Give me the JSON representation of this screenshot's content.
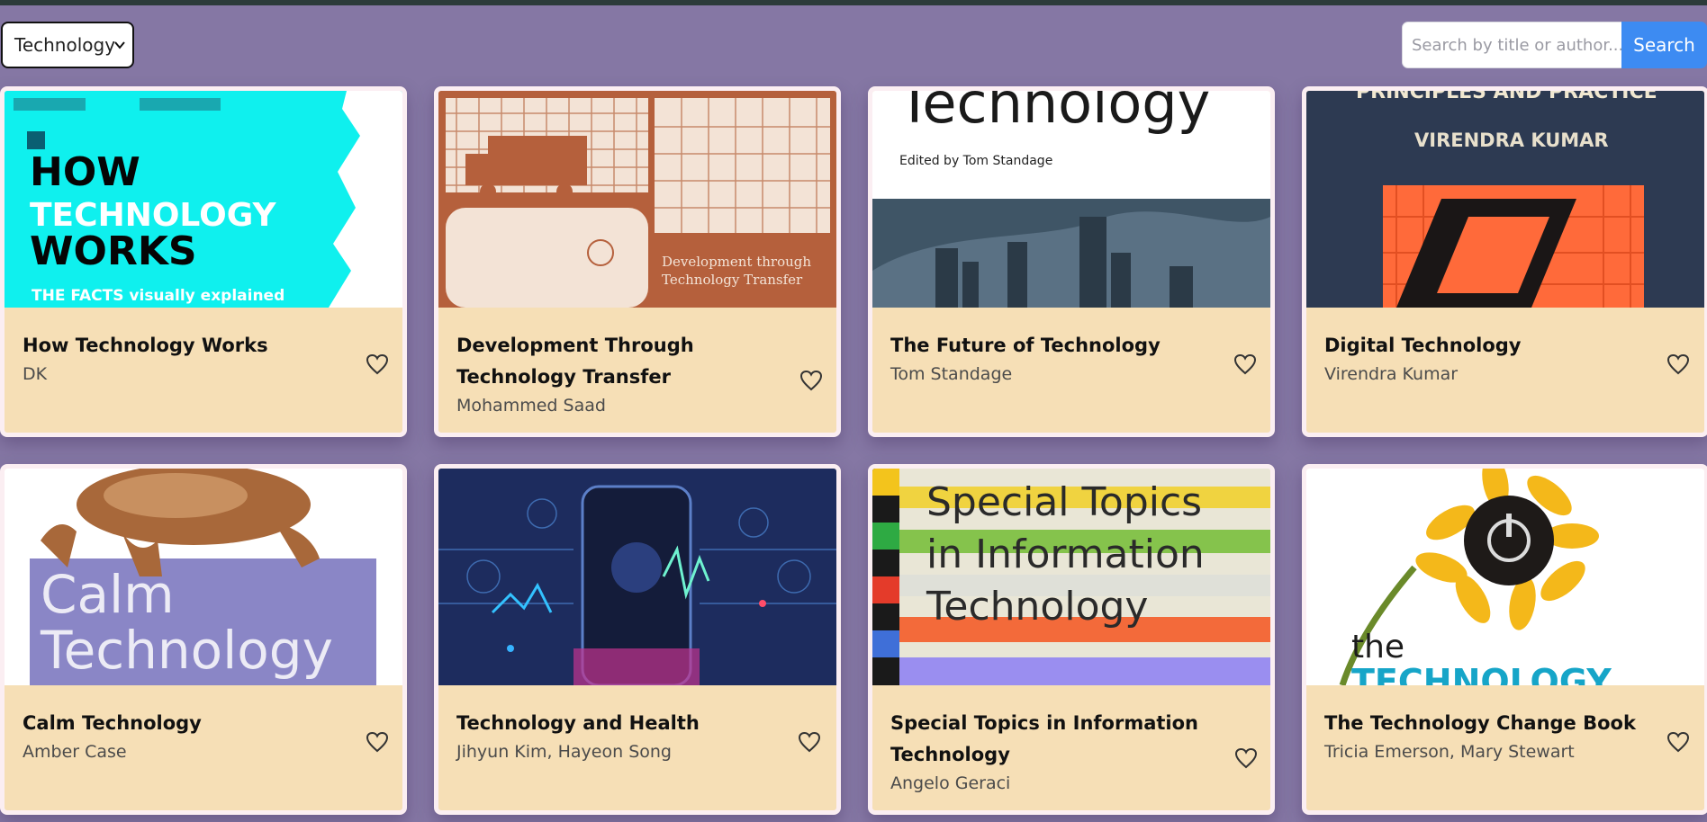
{
  "filter": {
    "selected": "Technology"
  },
  "search": {
    "placeholder": "Search by title or author...",
    "button_label": "Search"
  },
  "books": [
    {
      "title": "How Technology Works",
      "author": "DK",
      "cover_color": "#0ff0ee",
      "cover_text": [
        "HOW",
        "TECHNOLOGY",
        "WORKS",
        "THE FACTS visually explained"
      ]
    },
    {
      "title": "Development Through Technology Transfer",
      "author": "Mohammed Saad",
      "cover_color": "#b5603c",
      "cover_text": [
        "Development through",
        "Technology Transfer"
      ]
    },
    {
      "title": "The Future of Technology",
      "author": "Tom Standage",
      "cover_color": "#3f5566",
      "cover_text": [
        "Technology",
        "Edited by Tom Standage"
      ]
    },
    {
      "title": "Digital Technology",
      "author": "Virendra Kumar",
      "cover_color": "#2d3a52",
      "cover_text": [
        "PRINCIPLES AND PRACTICE",
        "VIRENDRA KUMAR"
      ]
    },
    {
      "title": "Calm Technology",
      "author": "Amber Case",
      "cover_color": "#8a86c6",
      "cover_text": [
        "Calm",
        "Technology"
      ]
    },
    {
      "title": "Technology and Health",
      "author": "Jihyun Kim, Hayeon Song",
      "cover_color": "#1d2c5e",
      "cover_text": []
    },
    {
      "title": "Special Topics in Information Technology",
      "author": "Angelo Geraci",
      "cover_color": "#e9e6d6",
      "cover_text": [
        "Special Topics",
        "in Information",
        "Technology"
      ]
    },
    {
      "title": "The Technology Change Book",
      "author": "Tricia Emerson, Mary Stewart",
      "cover_color": "#ffffff",
      "cover_text": [
        "the",
        "TECHNOLOGY"
      ]
    }
  ]
}
